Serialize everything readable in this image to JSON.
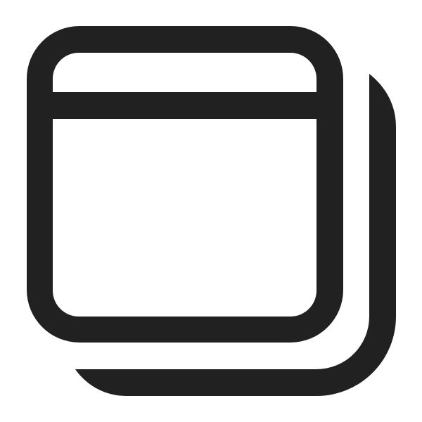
{
  "icon": {
    "name": "window-multiple-icon",
    "color": "#212121",
    "background": "#ffffff"
  }
}
